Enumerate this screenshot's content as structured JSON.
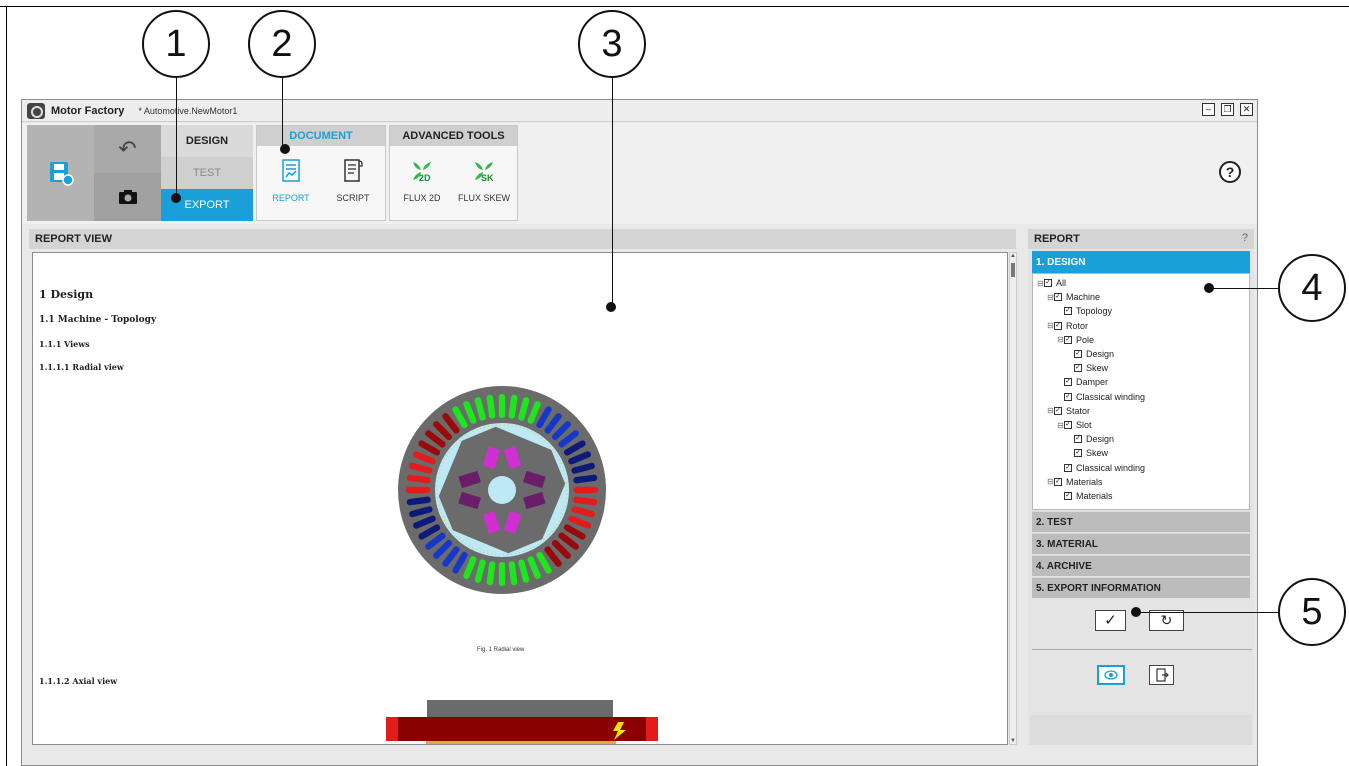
{
  "callouts": [
    "1",
    "2",
    "3",
    "4",
    "5"
  ],
  "window": {
    "app_name": "Motor Factory",
    "document_name": "* Automotive.NewMotor1",
    "controls": [
      "minimize",
      "restore",
      "close"
    ]
  },
  "ribbon": {
    "save_icon": "save-icon",
    "undo_icon": "undo-icon",
    "camera_icon": "camera-icon",
    "modes": {
      "design": "DESIGN",
      "test": "TEST",
      "export": "EXPORT"
    },
    "document_group": {
      "title": "DOCUMENT",
      "report": "REPORT",
      "script": "SCRIPT"
    },
    "advanced_group": {
      "title": "ADVANCED TOOLS",
      "flux2d": "FLUX 2D",
      "fluxskew": "FLUX SKEW",
      "flux2d_badge": "2D",
      "fluxskew_badge": "SK"
    },
    "help": "?"
  },
  "report_view": {
    "title": "REPORT VIEW",
    "h1": "1 Design",
    "h2": "1.1 Machine - Topology",
    "h3": "1.1.1 Views",
    "h4": "1.1.1.1 Radial view",
    "caption": "Fig. 1 Radial view",
    "h5": "1.1.1.2 Axial view"
  },
  "report_panel": {
    "title": "REPORT",
    "help": "?",
    "active_section": "1. DESIGN",
    "tree": [
      {
        "label": "All",
        "exp": "⊟",
        "level": 0
      },
      {
        "label": "Machine",
        "exp": "⊟",
        "level": 1
      },
      {
        "label": "Topology",
        "exp": "",
        "level": 2
      },
      {
        "label": "Rotor",
        "exp": "⊟",
        "level": 1
      },
      {
        "label": "Pole",
        "exp": "⊟",
        "level": 2
      },
      {
        "label": "Design",
        "exp": "",
        "level": 3
      },
      {
        "label": "Skew",
        "exp": "",
        "level": 3
      },
      {
        "label": "Damper",
        "exp": "",
        "level": 2
      },
      {
        "label": "Classical winding",
        "exp": "",
        "level": 2
      },
      {
        "label": "Stator",
        "exp": "⊟",
        "level": 1
      },
      {
        "label": "Slot",
        "exp": "⊟",
        "level": 2
      },
      {
        "label": "Design",
        "exp": "",
        "level": 3
      },
      {
        "label": "Skew",
        "exp": "",
        "level": 3
      },
      {
        "label": "Classical winding",
        "exp": "",
        "level": 2
      },
      {
        "label": "Materials",
        "exp": "⊟",
        "level": 1
      },
      {
        "label": "Materials",
        "exp": "",
        "level": 2
      }
    ],
    "sections": [
      "2. TEST",
      "3. MATERIAL",
      "4. ARCHIVE",
      "5. EXPORT INFORMATION"
    ],
    "apply": "✓",
    "reset": "↻"
  },
  "colors": {
    "accent": "#1a9fd9",
    "stator": "#6b6b6b",
    "rotor_bg": "#bde9f5",
    "magnet": "#d22fd2",
    "magnet_dark": "#6a1e6a",
    "winding_red": "#e31b1b",
    "winding_darkred": "#9b0a0a",
    "winding_blue": "#1638c9",
    "winding_navy": "#0d1a7a",
    "winding_green": "#1ee61e"
  }
}
